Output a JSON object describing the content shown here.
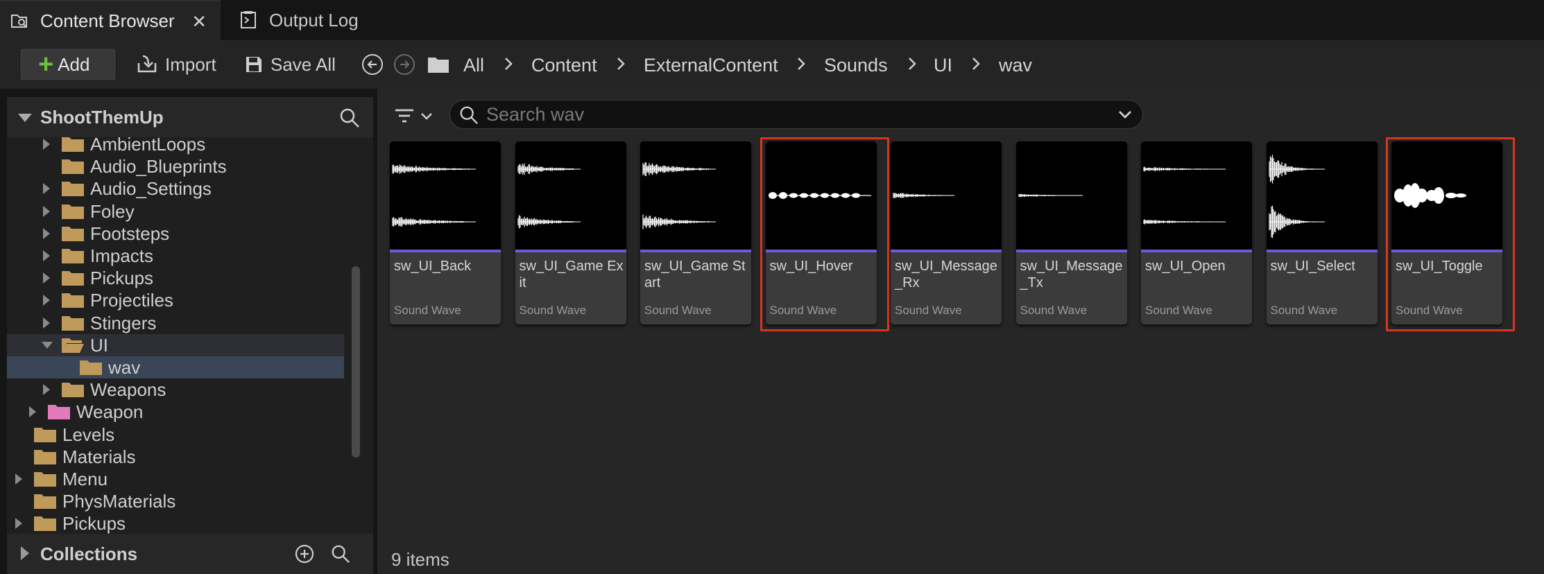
{
  "tabs": [
    {
      "label": "Content Browser",
      "icon": "content-browser-icon",
      "active": true
    },
    {
      "label": "Output Log",
      "icon": "output-log-icon",
      "active": false
    }
  ],
  "toolbar": {
    "add_label": "Add",
    "import_label": "Import",
    "save_all_label": "Save All",
    "breadcrumbs": [
      "All",
      "Content",
      "ExternalContent",
      "Sounds",
      "UI",
      "wav"
    ]
  },
  "left_panel": {
    "root_title": "ShootThemUp",
    "tree": [
      {
        "label": "AmbientLoops",
        "depth": 2,
        "expandable": true,
        "open": false,
        "color": "#c09a5b"
      },
      {
        "label": "Audio_Blueprints",
        "depth": 2,
        "expandable": false,
        "open": false,
        "color": "#c09a5b"
      },
      {
        "label": "Audio_Settings",
        "depth": 2,
        "expandable": true,
        "open": false,
        "color": "#c09a5b"
      },
      {
        "label": "Foley",
        "depth": 2,
        "expandable": true,
        "open": false,
        "color": "#c09a5b"
      },
      {
        "label": "Footsteps",
        "depth": 2,
        "expandable": true,
        "open": false,
        "color": "#c09a5b"
      },
      {
        "label": "Impacts",
        "depth": 2,
        "expandable": true,
        "open": false,
        "color": "#c09a5b"
      },
      {
        "label": "Pickups",
        "depth": 2,
        "expandable": true,
        "open": false,
        "color": "#c09a5b"
      },
      {
        "label": "Projectiles",
        "depth": 2,
        "expandable": true,
        "open": false,
        "color": "#c09a5b"
      },
      {
        "label": "Stingers",
        "depth": 2,
        "expandable": true,
        "open": false,
        "color": "#c09a5b"
      },
      {
        "label": "UI",
        "depth": 2,
        "expandable": true,
        "open": true,
        "color": "#c09a5b"
      },
      {
        "label": "wav",
        "depth": 3,
        "expandable": false,
        "open": false,
        "color": "#c09a5b",
        "selected": true
      },
      {
        "label": "Weapons",
        "depth": 2,
        "expandable": true,
        "open": false,
        "color": "#c09a5b"
      },
      {
        "label": "Weapon",
        "depth": 1,
        "expandable": true,
        "open": false,
        "color": "#e07ab8"
      },
      {
        "label": "Levels",
        "depth": 0,
        "expandable": false,
        "open": false,
        "color": "#c09a5b"
      },
      {
        "label": "Materials",
        "depth": 0,
        "expandable": false,
        "open": false,
        "color": "#c09a5b"
      },
      {
        "label": "Menu",
        "depth": 0,
        "expandable": true,
        "open": false,
        "color": "#c09a5b"
      },
      {
        "label": "PhysMaterials",
        "depth": 0,
        "expandable": false,
        "open": false,
        "color": "#c09a5b"
      },
      {
        "label": "Pickups",
        "depth": 0,
        "expandable": true,
        "open": false,
        "color": "#c09a5b"
      }
    ],
    "collections_label": "Collections"
  },
  "content": {
    "search_placeholder": "Search wav",
    "items_count": "9 items",
    "assets": [
      {
        "name": "sw_UI_Back",
        "type": "Sound Wave",
        "wave": "stereo-dense",
        "highlighted": false
      },
      {
        "name": "sw_UI_Game Exit",
        "type": "Sound Wave",
        "wave": "stereo-burst",
        "highlighted": false
      },
      {
        "name": "sw_UI_Game Start",
        "type": "Sound Wave",
        "wave": "stereo-long",
        "highlighted": false
      },
      {
        "name": "sw_UI_Hover",
        "type": "Sound Wave",
        "wave": "mono-pulses",
        "highlighted": true
      },
      {
        "name": "sw_UI_Message_Rx",
        "type": "Sound Wave",
        "wave": "mono-short",
        "highlighted": false
      },
      {
        "name": "sw_UI_Message_Tx",
        "type": "Sound Wave",
        "wave": "mono-thin",
        "highlighted": false
      },
      {
        "name": "sw_UI_Open",
        "type": "Sound Wave",
        "wave": "stereo-sparse",
        "highlighted": false
      },
      {
        "name": "sw_UI_Select",
        "type": "Sound Wave",
        "wave": "stereo-spike",
        "highlighted": false
      },
      {
        "name": "sw_UI_Toggle",
        "type": "Sound Wave",
        "wave": "mono-blobs",
        "highlighted": true
      }
    ]
  },
  "colors": {
    "accent_bar": "#6a5cd8",
    "highlight_frame": "#d9361f",
    "folder": "#c09a5b",
    "plugin_folder": "#e07ab8",
    "selection": "#3a4657"
  }
}
